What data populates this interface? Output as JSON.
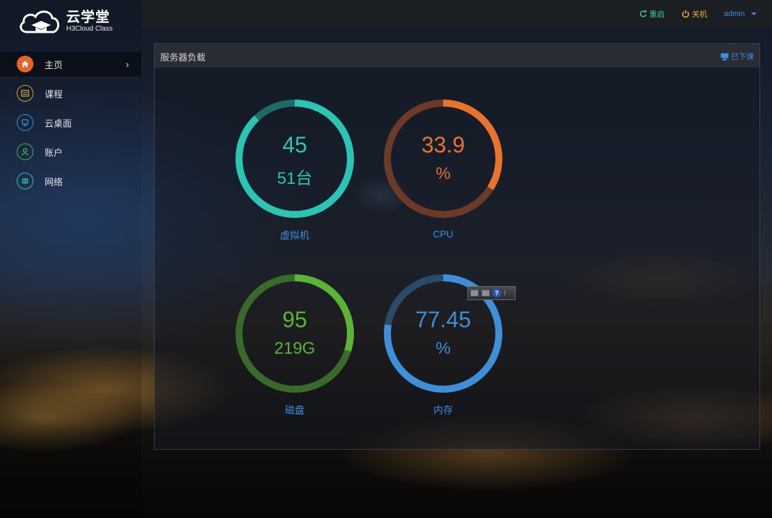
{
  "app": {
    "title": "云学堂",
    "subtitle": "H3Cloud Class"
  },
  "topbar": {
    "restart_label": "重启",
    "shutdown_label": "关机",
    "user_label": "admin"
  },
  "sidebar": {
    "items": [
      {
        "label": "主页",
        "icon": "home-icon",
        "color": "#e8622a"
      },
      {
        "label": "课程",
        "icon": "course-icon",
        "color": "#d7a23a"
      },
      {
        "label": "云桌面",
        "icon": "desktop-icon",
        "color": "#3a8fe0"
      },
      {
        "label": "账户",
        "icon": "user-icon",
        "color": "#4caf50"
      },
      {
        "label": "网络",
        "icon": "globe-icon",
        "color": "#2ec6b5"
      }
    ]
  },
  "panel": {
    "title": "服务器负载",
    "link_label": "已下课"
  },
  "gauges": [
    {
      "value": "45",
      "sub": "51台",
      "label": "虚拟机",
      "fraction": 0.88,
      "color": "#2ac5b3",
      "track": "#1d6b66"
    },
    {
      "value": "33.9",
      "sub": "%",
      "label": "CPU",
      "fraction": 0.339,
      "color": "#e8732d",
      "track": "#6b3a28"
    },
    {
      "value": "95",
      "sub": "219G",
      "label": "磁盘",
      "fraction": 0.3,
      "color": "#5ab535",
      "track": "#3a6a2a"
    },
    {
      "value": "77.45",
      "sub": "%",
      "label": "内存",
      "fraction": 0.7745,
      "color": "#3f8ed8",
      "track": "#2a4a6a"
    }
  ],
  "colors": {
    "accent": "#3a8fe0",
    "restart": "#3cc6a6",
    "shutdown": "#e5b530"
  }
}
